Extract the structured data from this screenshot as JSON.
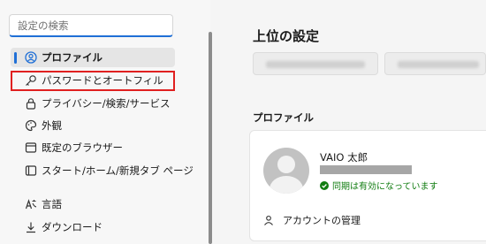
{
  "search": {
    "placeholder": "設定の検索"
  },
  "sidebar": {
    "items": [
      {
        "label": "プロファイル",
        "icon": "profile-icon",
        "selected": true
      },
      {
        "label": "パスワードとオートフィル",
        "icon": "key-icon"
      },
      {
        "label": "プライバシー/検索/サービス",
        "icon": "lock-icon"
      },
      {
        "label": "外観",
        "icon": "palette-icon"
      },
      {
        "label": "既定のブラウザー",
        "icon": "browser-icon"
      },
      {
        "label": "スタート/ホーム/新規タブ ページ",
        "icon": "home-icon"
      },
      {
        "label": "言語",
        "icon": "language-icon"
      },
      {
        "label": "ダウンロード",
        "icon": "download-icon"
      }
    ]
  },
  "main": {
    "title": "上位の設定",
    "section_title": "プロファイル",
    "profile": {
      "name": "VAIO 太郎",
      "sync_status": "同期は有効になっています",
      "manage_account": "アカウントの管理"
    }
  },
  "colors": {
    "accent": "#1f6fd6",
    "highlight": "#e02020",
    "sync_green": "#107c10"
  }
}
